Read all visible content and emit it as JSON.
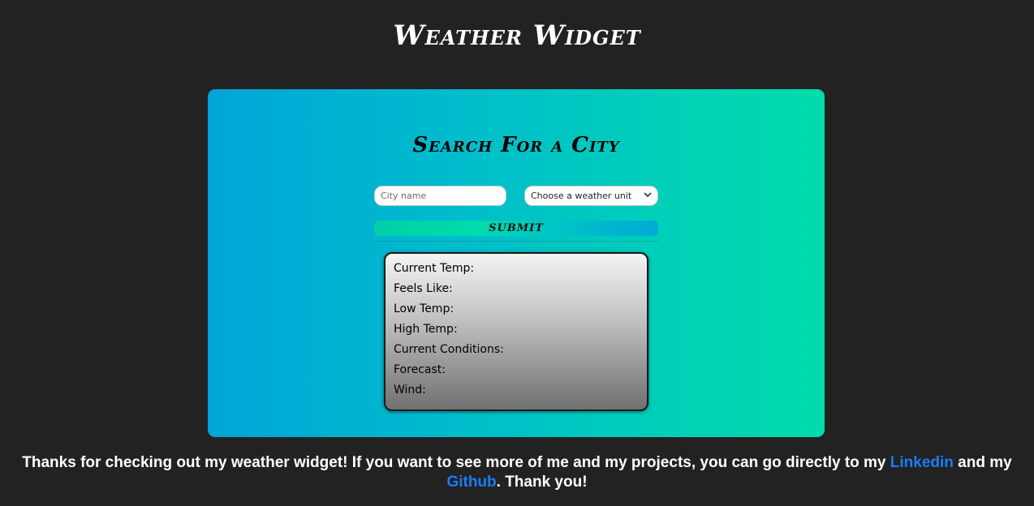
{
  "page": {
    "title": "Weather Widget"
  },
  "search": {
    "heading": "Search For a City",
    "city_placeholder": "City name",
    "unit_selected": "Choose a weather unit",
    "submit_label": "submit"
  },
  "results": {
    "rows": [
      {
        "label": "Current Temp:"
      },
      {
        "label": "Feels Like:"
      },
      {
        "label": "Low Temp:"
      },
      {
        "label": "High Temp:"
      },
      {
        "label": "Current Conditions:"
      },
      {
        "label": "Forecast:"
      },
      {
        "label": "Wind:"
      }
    ]
  },
  "footer": {
    "text_before": "Thanks for checking out my weather widget! If you want to see more of me and my projects, you can go directly to my ",
    "linkedin_label": "Linkedin",
    "text_middle": " and my ",
    "github_label": "Github",
    "text_after": ". Thank you!"
  },
  "colors": {
    "background": "#222222",
    "card_gradient_start": "#00a5d8",
    "card_gradient_end": "#00dcab",
    "link": "#1a7cf5"
  }
}
